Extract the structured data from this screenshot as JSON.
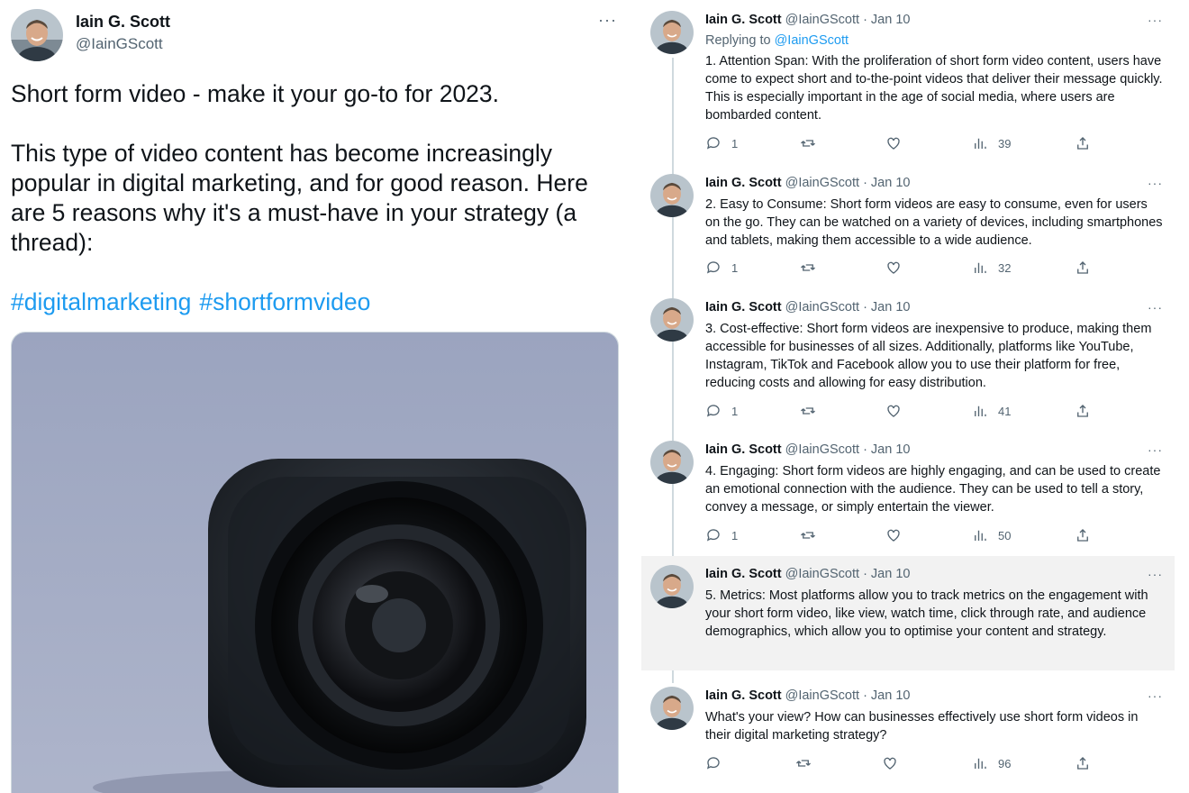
{
  "main_tweet": {
    "author": "Iain G. Scott",
    "handle": "@IainGScott",
    "more": "···",
    "paragraphs": [
      "Short form video - make it your go-to for 2023.",
      "This type of video content has become increasingly popular in digital marketing, and for good reason. Here are 5 reasons why it's a must-have in your strategy (a thread):"
    ],
    "hashtags": [
      "#digitalmarketing",
      "#shortformvideo"
    ],
    "media_icon": "camera-photo"
  },
  "thread": [
    {
      "author": "Iain G. Scott",
      "meta": "@IainGScott · Jan 10",
      "replying_prefix": "Replying to ",
      "replying_to": "@IainGScott",
      "text": "1. Attention Span: With the proliferation of short form video content, users have come to expect short and to-the-point videos that deliver their message quickly. This is especially important in the age of social media, where users are bombarded content.",
      "replies": "1",
      "views": "39"
    },
    {
      "author": "Iain G. Scott",
      "meta": "@IainGScott · Jan 10",
      "text": "2. Easy to Consume: Short form videos are easy to consume, even for users on the go. They can be watched on a variety of devices, including smartphones and tablets, making them accessible to a wide audience.",
      "replies": "1",
      "views": "32"
    },
    {
      "author": "Iain G. Scott",
      "meta": "@IainGScott · Jan 10",
      "text": "3. Cost-effective: Short form videos are inexpensive to produce, making them accessible for businesses of all sizes. Additionally, platforms like YouTube, Instagram, TikTok and Facebook allow you to use their platform for free, reducing costs and allowing for easy distribution.",
      "replies": "1",
      "views": "41"
    },
    {
      "author": "Iain G. Scott",
      "meta": "@IainGScott · Jan 10",
      "text": "4. Engaging: Short form videos are highly engaging, and can be used to create an emotional connection with the audience. They can be used to tell a story, convey a message, or simply entertain the viewer.",
      "replies": "1",
      "views": "50"
    },
    {
      "author": "Iain G. Scott",
      "meta": "@IainGScott · Jan 10",
      "text": "5. Metrics: Most platforms allow you to track metrics on the engagement with your short form video, like view, watch time, click through rate, and audience demographics, which allow you to optimise your content and strategy."
    },
    {
      "author": "Iain G. Scott",
      "meta": "@IainGScott · Jan 10",
      "text": "What's your view? How can businesses effectively use short form videos in their digital marketing strategy?",
      "replies": "",
      "views": "96"
    }
  ],
  "more_label": "···",
  "colors": {
    "text": "#0f1419",
    "secondary": "#536471",
    "link": "#1d9bf0",
    "highlight_bg": "#f2f2f2",
    "thread_line": "#cfd9de"
  },
  "icons": [
    "reply-icon",
    "retweet-icon",
    "like-icon",
    "views-icon",
    "share-icon",
    "more-icon",
    "avatar"
  ]
}
